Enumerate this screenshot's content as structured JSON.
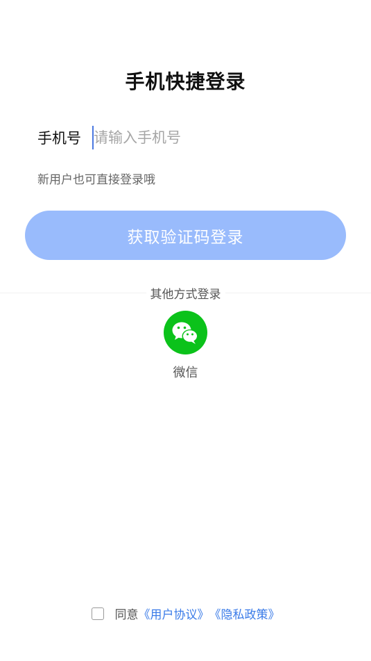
{
  "page": {
    "title": "手机快捷登录"
  },
  "phone": {
    "label": "手机号",
    "placeholder": "请输入手机号",
    "value": ""
  },
  "hint": "新用户也可直接登录哦",
  "login_button": "获取验证码登录",
  "other_login": {
    "label": "其他方式登录",
    "wechat_label": "微信",
    "wechat_icon": "wechat-icon",
    "wechat_color": "#0bc21a"
  },
  "agreement": {
    "checked": false,
    "prefix": "同意",
    "user_agreement": "《用户协议》",
    "privacy_policy": "《隐私政策》"
  },
  "colors": {
    "button_bg": "#99bbfc",
    "link": "#3a7be8",
    "cursor": "#4a78e0"
  }
}
